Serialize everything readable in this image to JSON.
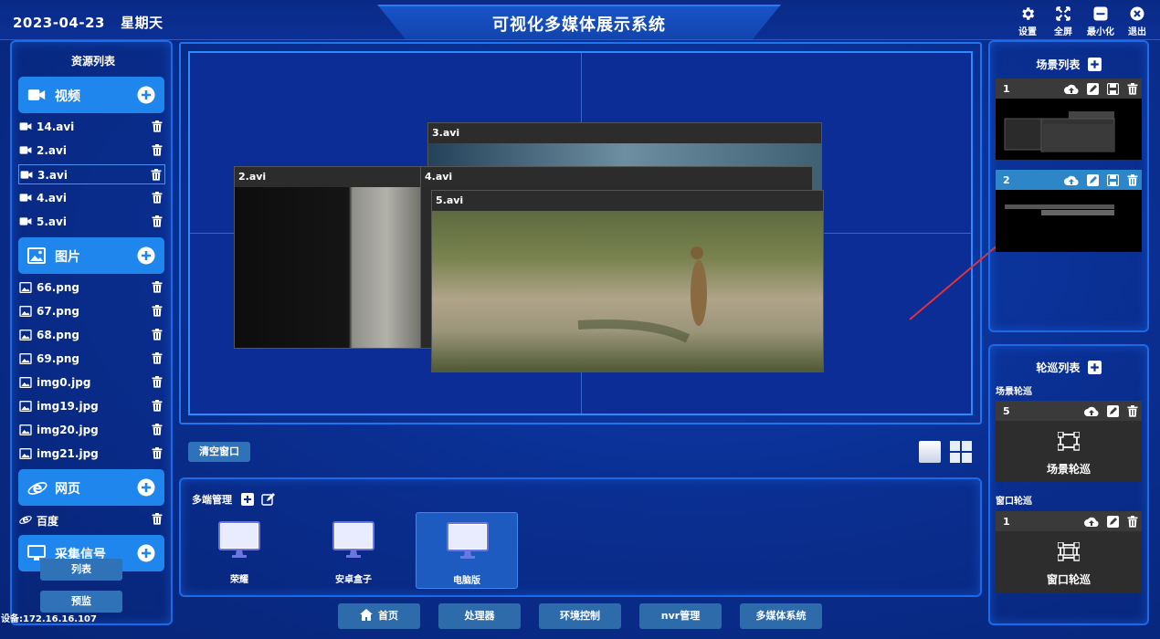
{
  "header": {
    "date": "2023-04-23",
    "weekday": "星期天",
    "title": "可视化多媒体展示系统",
    "buttons": [
      {
        "label": "设置",
        "icon": "gear-icon"
      },
      {
        "label": "全屏",
        "icon": "fullscreen-icon"
      },
      {
        "label": "最小化",
        "icon": "minimize-icon"
      },
      {
        "label": "退出",
        "icon": "close-icon"
      }
    ]
  },
  "resources": {
    "title": "资源列表",
    "categories": {
      "video": {
        "label": "视频",
        "icon": "video-camera-icon"
      },
      "image": {
        "label": "图片",
        "icon": "image-icon"
      },
      "web": {
        "label": "网页",
        "icon": "ie-browser-icon"
      },
      "capture": {
        "label": "采集信号",
        "icon": "monitor-icon"
      }
    },
    "videos": [
      "14.avi",
      "2.avi",
      "3.avi",
      "4.avi",
      "5.avi"
    ],
    "images": [
      "66.png",
      "67.png",
      "68.png",
      "69.png",
      "img0.jpg",
      "img19.jpg",
      "img20.jpg",
      "img21.jpg"
    ],
    "webs": [
      "百度"
    ],
    "selected_item": "3.avi"
  },
  "left_buttons": {
    "list": "列表",
    "preview": "预监"
  },
  "device_ip": "设备:172.16.16.107",
  "display": {
    "windows": [
      "3.avi",
      "2.avi",
      "4.avi",
      "5.avi"
    ]
  },
  "clear_button": "清空窗口",
  "multi": {
    "title": "多端管理",
    "terminals": [
      {
        "label": "荣耀",
        "selected": false
      },
      {
        "label": "安卓盒子",
        "selected": false
      },
      {
        "label": "电脑版",
        "selected": true
      }
    ]
  },
  "nav": [
    "首页",
    "处理器",
    "环境控制",
    "nvr管理",
    "多媒体系统"
  ],
  "scenes": {
    "title": "场景列表",
    "items": [
      {
        "num": "1",
        "active": false
      },
      {
        "num": "2",
        "active": true
      }
    ]
  },
  "tours": {
    "title": "轮巡列表",
    "scene_tour_title": "场景轮巡",
    "scene_tour": {
      "num": "5",
      "label": "场景轮巡"
    },
    "window_tour_title": "窗口轮巡",
    "window_tour": {
      "num": "1",
      "label": "窗口轮巡"
    }
  },
  "colors": {
    "accent": "#1f86ee",
    "background": "#0a2f92",
    "active_card": "#2d86c8",
    "arrow": "#e0323a"
  }
}
